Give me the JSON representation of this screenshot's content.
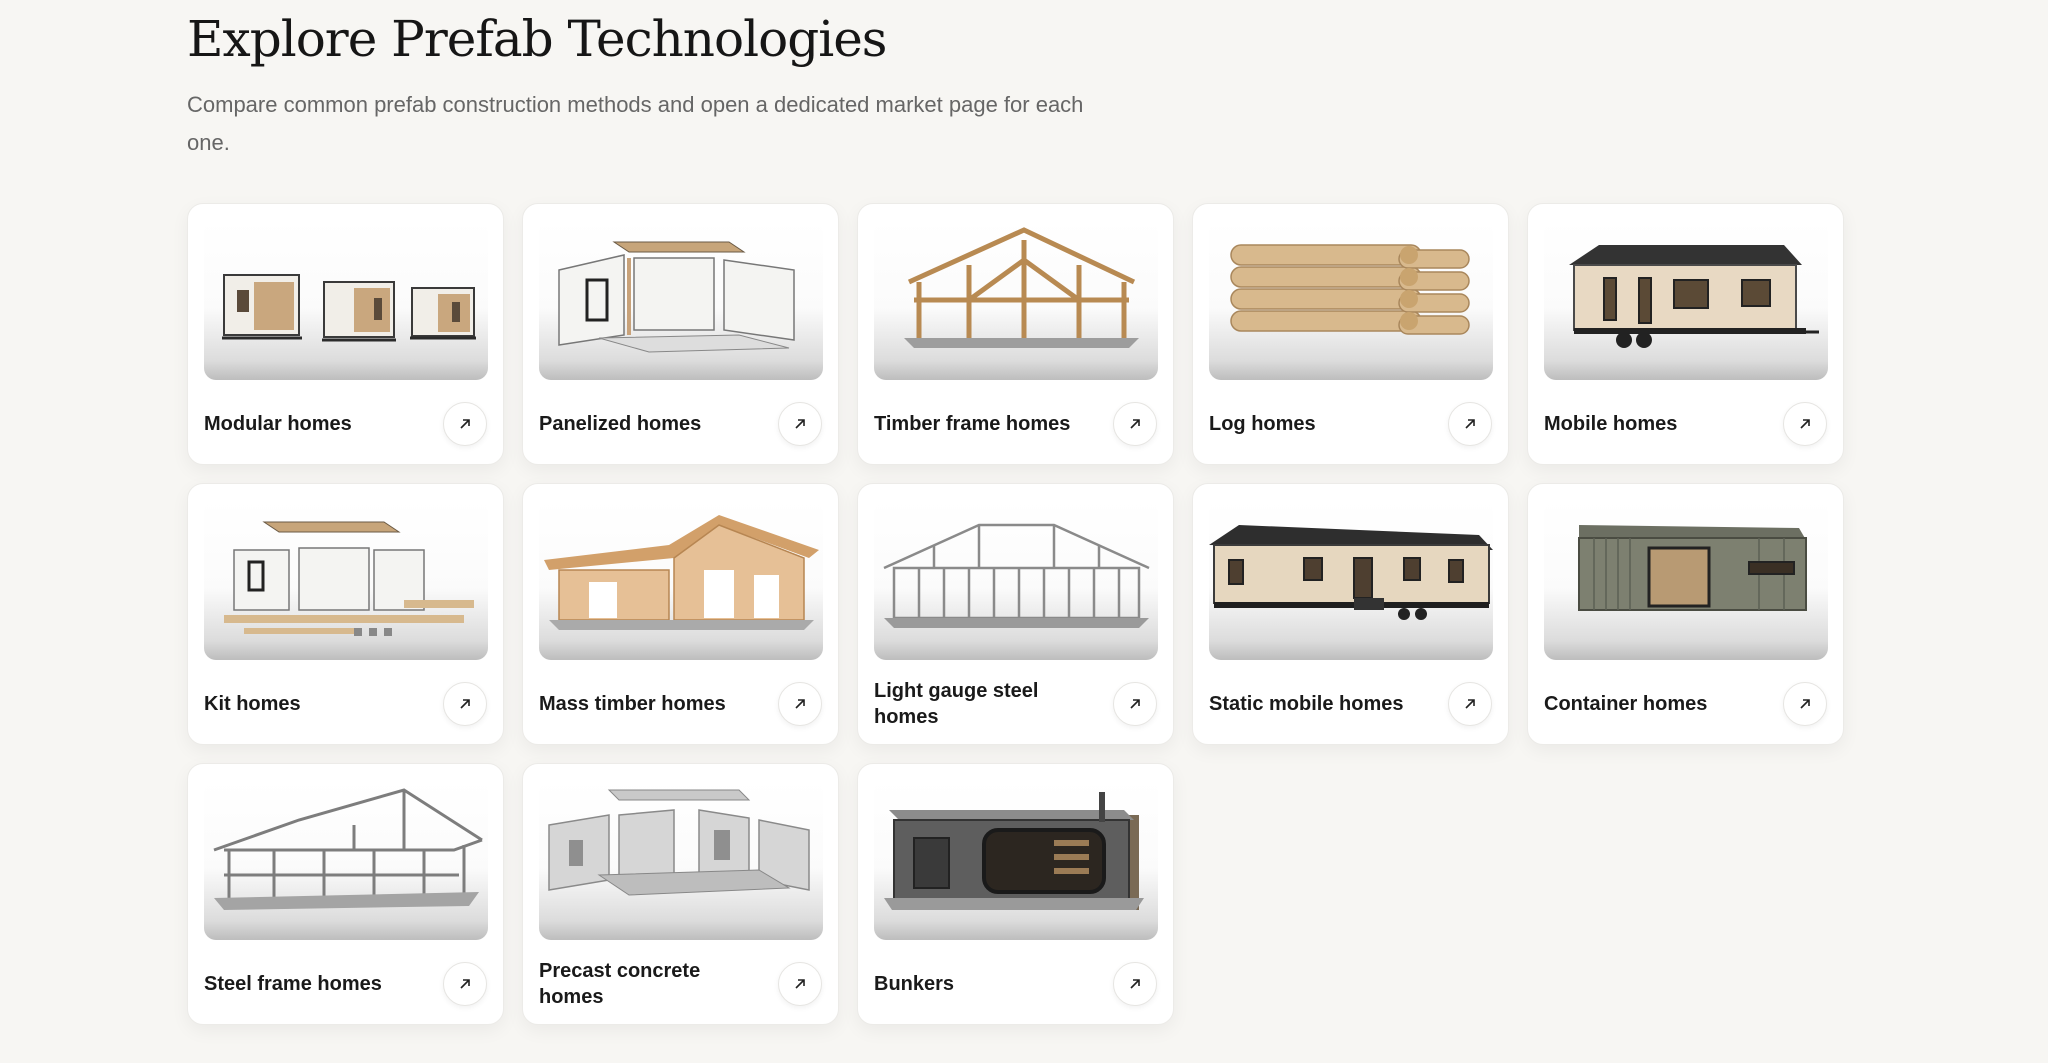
{
  "header": {
    "title": "Explore Prefab Technologies",
    "subtitle": "Compare common prefab construction methods and open a dedicated market page for each one."
  },
  "cards": [
    {
      "label": "Modular homes",
      "image": "modular-homes-image",
      "icon": "arrow-up-right-icon"
    },
    {
      "label": "Panelized homes",
      "image": "panelized-homes-image",
      "icon": "arrow-up-right-icon"
    },
    {
      "label": "Timber frame homes",
      "image": "timber-frame-homes-image",
      "icon": "arrow-up-right-icon"
    },
    {
      "label": "Log homes",
      "image": "log-homes-image",
      "icon": "arrow-up-right-icon"
    },
    {
      "label": "Mobile homes",
      "image": "mobile-homes-image",
      "icon": "arrow-up-right-icon"
    },
    {
      "label": "Kit homes",
      "image": "kit-homes-image",
      "icon": "arrow-up-right-icon"
    },
    {
      "label": "Mass timber homes",
      "image": "mass-timber-homes-image",
      "icon": "arrow-up-right-icon"
    },
    {
      "label": "Light gauge steel homes",
      "image": "light-gauge-steel-homes-image",
      "icon": "arrow-up-right-icon"
    },
    {
      "label": "Static mobile homes",
      "image": "static-mobile-homes-image",
      "icon": "arrow-up-right-icon"
    },
    {
      "label": "Container homes",
      "image": "container-homes-image",
      "icon": "arrow-up-right-icon"
    },
    {
      "label": "Steel frame homes",
      "image": "steel-frame-homes-image",
      "icon": "arrow-up-right-icon"
    },
    {
      "label": "Precast concrete homes",
      "image": "precast-concrete-homes-image",
      "icon": "arrow-up-right-icon"
    },
    {
      "label": "Bunkers",
      "image": "bunkers-image",
      "icon": "arrow-up-right-icon"
    }
  ],
  "colors": {
    "background": "#f7f6f3",
    "card": "#ffffff",
    "text": "#1a1a1a",
    "muted": "#666666"
  }
}
